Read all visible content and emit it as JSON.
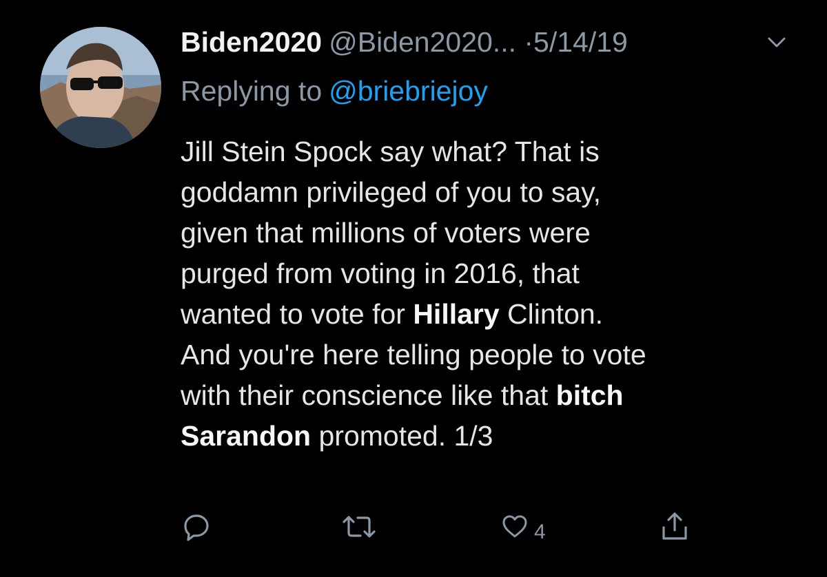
{
  "tweet": {
    "display_name": "Biden2020",
    "handle": "@Biden2020...",
    "separator": "·",
    "timestamp": "5/14/19",
    "reply_prefix": "Replying to",
    "reply_handle": "@briebriejoy",
    "body_lines": [
      [
        {
          "text": "Jill Stein Spock say what? That is",
          "bold": false
        }
      ],
      [
        {
          "text": "goddamn privileged of you to say,",
          "bold": false
        }
      ],
      [
        {
          "text": "given that millions of voters were",
          "bold": false
        }
      ],
      [
        {
          "text": "purged from voting in 2016, that",
          "bold": false
        }
      ],
      [
        {
          "text": "wanted to vote for ",
          "bold": false
        },
        {
          "text": "Hillary",
          "bold": true
        },
        {
          "text": " Clinton.",
          "bold": false
        }
      ],
      [
        {
          "text": "And you're here telling people to vote",
          "bold": false
        }
      ],
      [
        {
          "text": "with their conscience like that ",
          "bold": false
        },
        {
          "text": "bitch",
          "bold": true
        }
      ],
      [
        {
          "text": "Sarandon",
          "bold": true
        },
        {
          "text": " promoted. 1/3",
          "bold": false
        }
      ]
    ],
    "like_count": "4"
  },
  "icons": {
    "avatar": "profile-photo",
    "more": "chevron-down-icon",
    "reply": "reply-icon",
    "retweet": "retweet-icon",
    "like": "heart-icon",
    "share": "share-icon"
  },
  "colors": {
    "background": "#000000",
    "text": "#e6e6e6",
    "muted": "#8b98a5",
    "link": "#1da1f2"
  }
}
